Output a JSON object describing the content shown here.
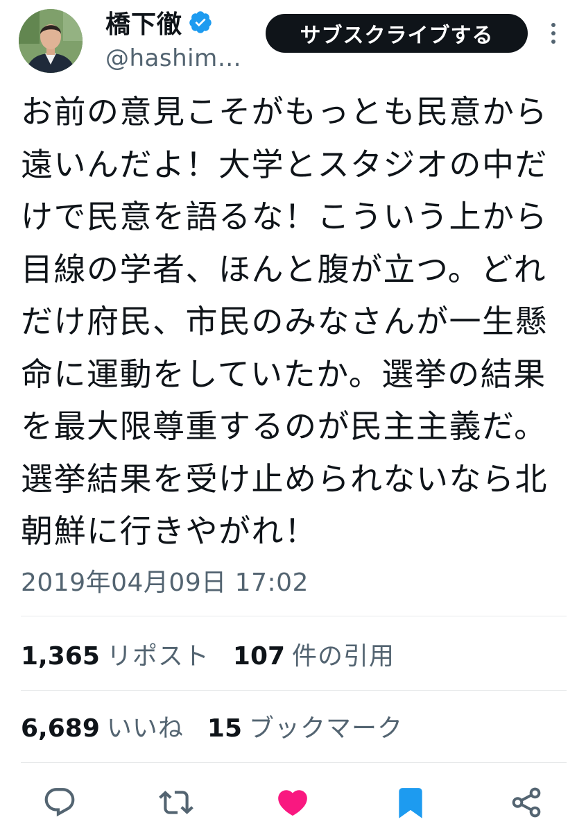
{
  "author": {
    "display_name": "橋下徹",
    "handle": "@hashim…",
    "verified": true,
    "avatar_icon": "profile-photo"
  },
  "header": {
    "subscribe_label": "サブスクライブする",
    "more_icon": "more-vertical-icon"
  },
  "tweet": {
    "text": "お前の意見こそがもっとも民意から遠いんだよ！大学とスタジオの中だけで民意を語るな！こういう上から目線の学者、ほんと腹が立つ。どれだけ府民、市民のみなさんが一生懸命に運動をしていたか。選挙の結果を最大限尊重するのが民主主義だ。選挙結果を受け止められないなら北朝鮮に行きやがれ！",
    "timestamp": "2019年04月09日 17:02"
  },
  "stats": {
    "reposts": {
      "count": "1,365",
      "label": "リポスト"
    },
    "quotes": {
      "count": "107",
      "label": "件の引用"
    },
    "likes": {
      "count": "6,689",
      "label": "いいね"
    },
    "bookmarks": {
      "count": "15",
      "label": "ブックマーク"
    }
  },
  "actions": {
    "reply_icon": "reply-icon",
    "repost_icon": "repost-icon",
    "like_icon": "heart-icon",
    "bookmark_icon": "bookmark-icon",
    "share_icon": "share-icon",
    "liked": true,
    "bookmarked": true
  },
  "colors": {
    "verified": "#1d9bf0",
    "like_active": "#f91880",
    "bookmark_active": "#1d9bf0",
    "secondary_text": "#536471",
    "button_bg": "#0f1419"
  }
}
